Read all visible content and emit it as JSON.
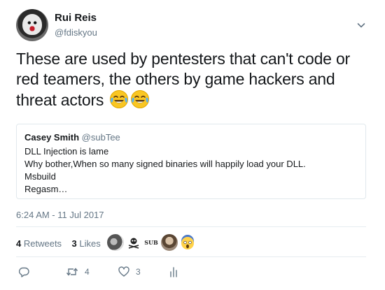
{
  "author": {
    "name": "Rui Reis",
    "handle": "@fdiskyou"
  },
  "tweet": {
    "text": "These are used by pentesters that can't code or red teamers, the others by game hackers and threat actors",
    "emojis": [
      "crying-laughing-emoji",
      "crying-laughing-emoji"
    ]
  },
  "quoted": {
    "name": "Casey Smith",
    "handle": "@subTee",
    "lines": [
      "DLL Injection is lame",
      "Why bother,When so many signed binaries will happily load your DLL.",
      "Msbuild",
      "Regasm…"
    ]
  },
  "timestamp": "6:24 AM - 11 Jul 2017",
  "stats": {
    "retweets_count": "4",
    "retweets_label": "Retweets",
    "likes_count": "3",
    "likes_label": "Likes"
  },
  "likers_sub_text": "SUB",
  "actions": {
    "reply_icon": "reply-icon",
    "retweet_icon": "retweet-icon",
    "retweet_count": "4",
    "like_icon": "heart-icon",
    "like_count": "3",
    "analytics_icon": "analytics-icon"
  },
  "colors": {
    "text": "#14171a",
    "secondary": "#657786",
    "border": "#e1e8ed",
    "action_blue": "#1da1f2"
  }
}
